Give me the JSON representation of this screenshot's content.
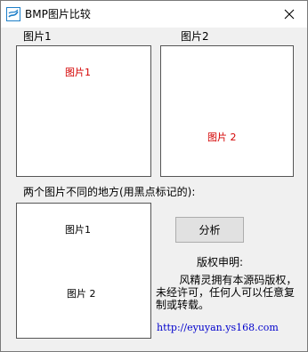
{
  "window": {
    "title": "BMP图片比较"
  },
  "labels": {
    "pic1": "图片1",
    "pic2": "图片2",
    "diff": "两个图片不同的地方(用黑点标记的):"
  },
  "pic1_box": {
    "text": "图片1"
  },
  "pic2_box": {
    "text": "图片 2"
  },
  "diff_box": {
    "text1": "图片1",
    "text2": "图片 2"
  },
  "button": {
    "label": "分析"
  },
  "copyright": {
    "title": "版权申明:",
    "body": "风精灵拥有本源码版权，未经许可，任何人可以任意复制或转载。",
    "url": "http://eyuyan.ys168.com"
  },
  "colors": {
    "marker_text": "#d40000",
    "link": "#0000cc"
  }
}
